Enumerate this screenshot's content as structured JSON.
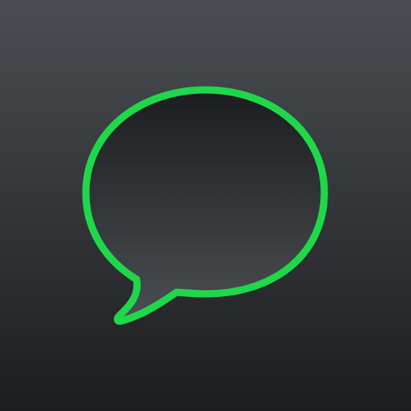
{
  "icon": {
    "name": "chat-bubble-icon",
    "colors": {
      "background_top": "#4a4e52",
      "background_bottom": "#1c1d1f",
      "bubble_fill_top": "#1c1d1f",
      "bubble_fill_bottom": "#4a4e52",
      "bubble_outline": "#1ed84a"
    }
  }
}
